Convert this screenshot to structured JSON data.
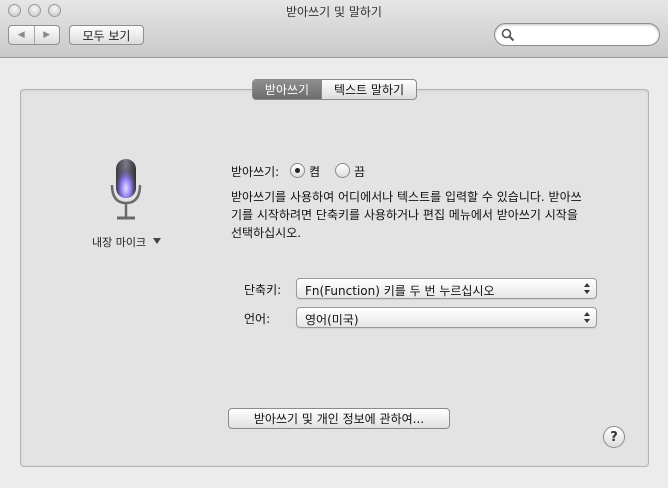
{
  "window": {
    "title": "받아쓰기 및 말하기"
  },
  "toolbar": {
    "back_label": "◀",
    "forward_label": "▶",
    "show_all_label": "모두 보기",
    "search_value": ""
  },
  "tabs": [
    {
      "label": "받아쓰기",
      "selected": true
    },
    {
      "label": "텍스트 말하기",
      "selected": false
    }
  ],
  "mic": {
    "source_label": "내장 마이크"
  },
  "dictation": {
    "label": "받아쓰기:",
    "option_on": "켬",
    "option_off": "끔",
    "selected": "켬",
    "description_lines": [
      "받아쓰기를 사용하여 어디에서나 텍스트를 입력할 수 있습니다. 받아쓰",
      "기를 시작하려면 단축키를 사용하거나 편집 메뉴에서 받아쓰기 시작을",
      "선택하십시오."
    ]
  },
  "shortcut": {
    "label": "단축키:",
    "value": "Fn(Function) 키를 두 번 누르십시오"
  },
  "language": {
    "label": "언어:",
    "value": "영어(미국)"
  },
  "privacy_button_label": "받아쓰기 및 개인 정보에 관하여...",
  "help_label": "?"
}
